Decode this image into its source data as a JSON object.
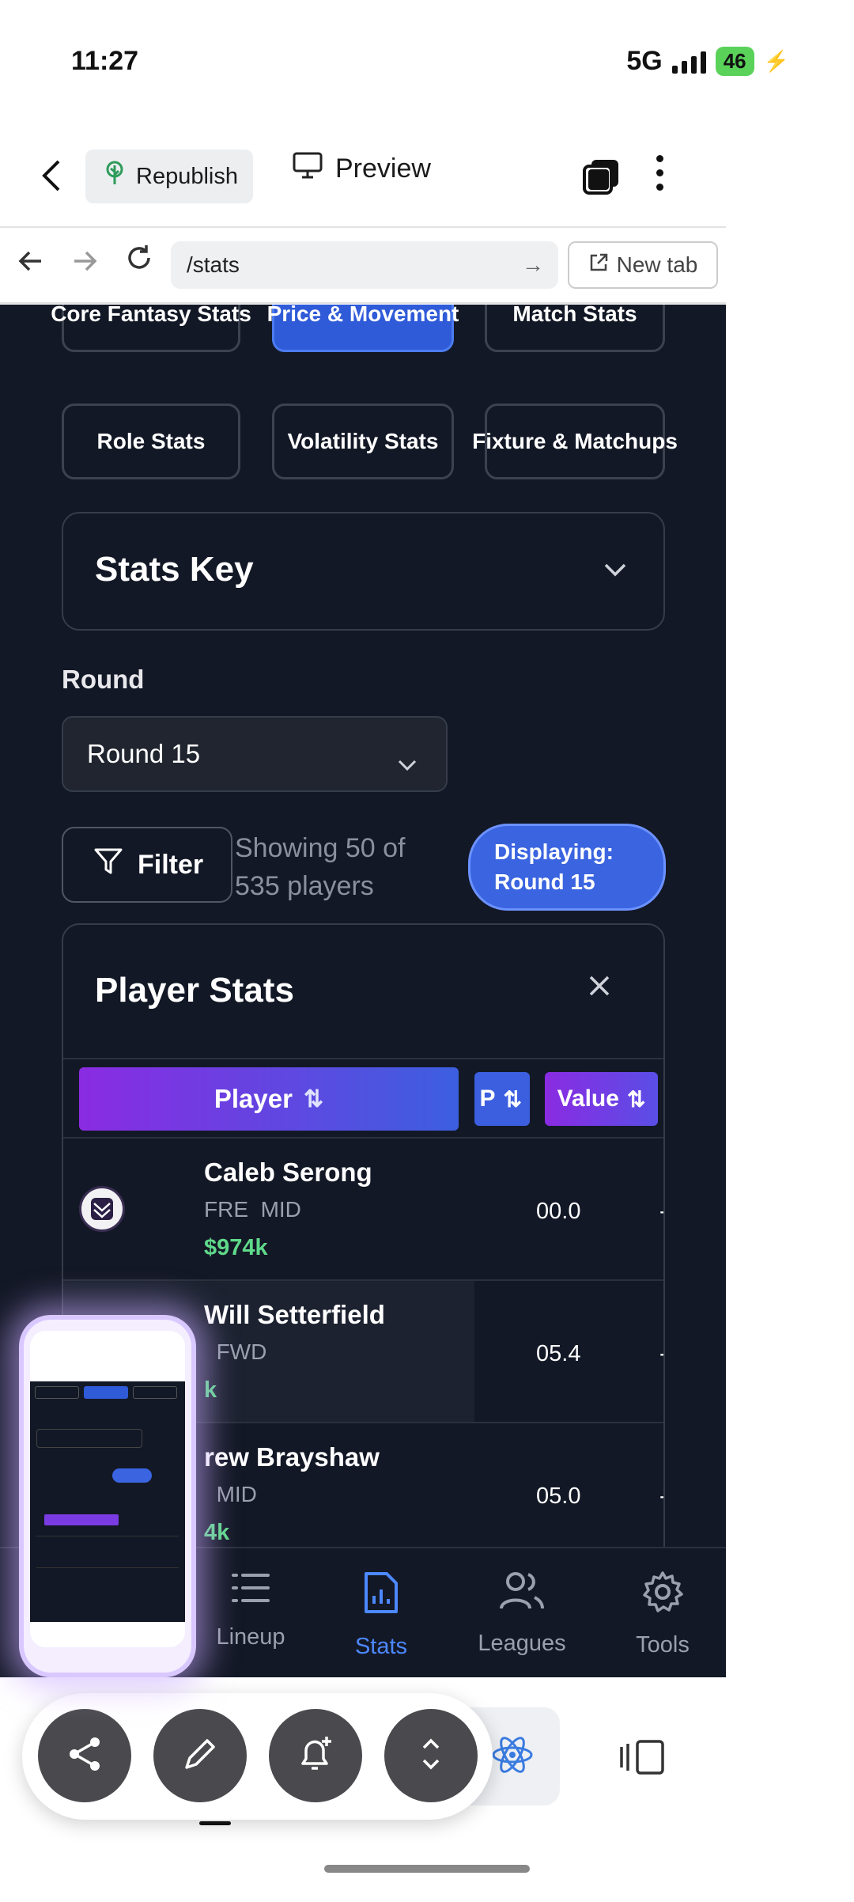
{
  "status_bar": {
    "time": "11:27",
    "network": "5G",
    "battery": "46"
  },
  "app_bar": {
    "republish_label": "Republish",
    "preview_label": "Preview"
  },
  "url_bar": {
    "path": "/stats",
    "new_tab_label": "New tab"
  },
  "category_tabs": [
    {
      "label": "Core Fantasy Stats",
      "active": false
    },
    {
      "label": "Price & Movement",
      "active": true
    },
    {
      "label": "Match Stats",
      "active": false
    },
    {
      "label": "Role Stats",
      "active": false
    },
    {
      "label": "Volatility Stats",
      "active": false
    },
    {
      "label": "Fixture & Matchups",
      "active": false
    }
  ],
  "stats_key": {
    "title": "Stats Key"
  },
  "round": {
    "label": "Round",
    "selected": "Round 15"
  },
  "filter": {
    "label": "Filter",
    "showing_line1": "Showing 50 of",
    "showing_line2": "535 players",
    "displaying_line1": "Displaying:",
    "displaying_line2": "Round 15"
  },
  "player_stats": {
    "title": "Player Stats",
    "columns": {
      "player": "Player",
      "second": "P",
      "value": "Value"
    },
    "rows": [
      {
        "name": "Caleb Serong",
        "team": "FRE",
        "position": "MID",
        "price": "$974k",
        "stat": "00.0",
        "value": "-"
      },
      {
        "name": "Will Setterfield",
        "team": "",
        "position": "FWD",
        "price": "k",
        "stat": "05.4",
        "value": "-"
      },
      {
        "name": "rew Brayshaw",
        "team": "",
        "position": "MID",
        "price": "4k",
        "stat": "05.0",
        "value": "-"
      }
    ]
  },
  "bottom_nav": [
    {
      "label": "Lineup",
      "active": false
    },
    {
      "label": "Stats",
      "active": true
    },
    {
      "label": "Leagues",
      "active": false
    },
    {
      "label": "Tools",
      "active": false
    }
  ],
  "colors": {
    "accent": "#3a64e0",
    "background": "#131826",
    "price_green": "#5fd98a",
    "active_nav": "#4c88ff"
  }
}
